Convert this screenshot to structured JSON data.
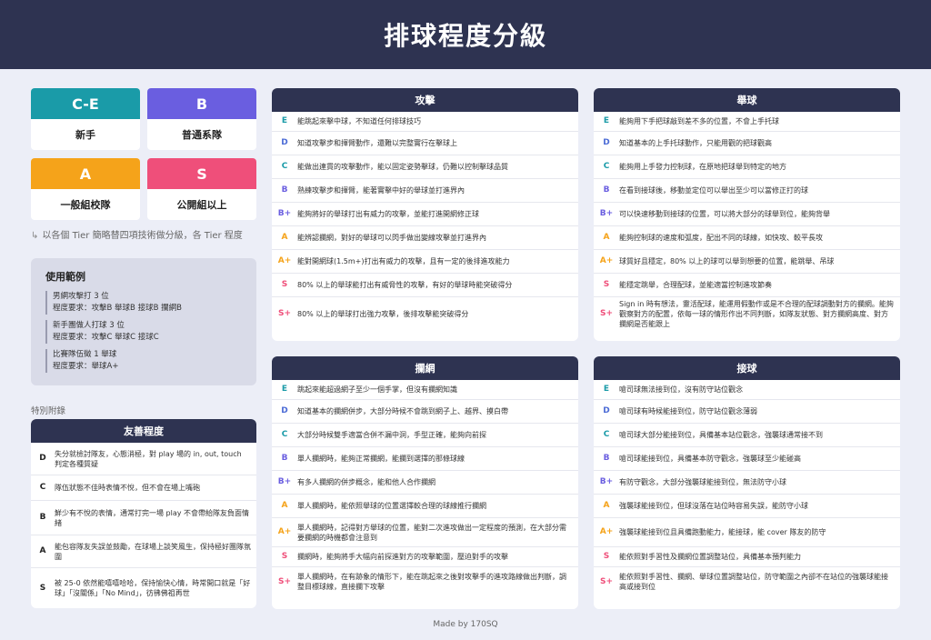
{
  "title": "排球程度分級",
  "colors": {
    "header_bg": "#2e3351",
    "E": "#1a9ba8",
    "D": "#4b6bd6",
    "C": "#1a9ba8",
    "B": "#6a5ee0",
    "Bplus": "#6a5ee0",
    "A": "#f5a31a",
    "Aplus": "#f5a31a",
    "S": "#ef4f7a",
    "Splus": "#ef4f7a"
  },
  "tiers": [
    {
      "badge": "C-E",
      "label": "新手",
      "color": "#1a9ba8"
    },
    {
      "badge": "B",
      "label": "普通系隊",
      "color": "#6a5ee0"
    },
    {
      "badge": "A",
      "label": "一般組校隊",
      "color": "#f5a31a"
    },
    {
      "badge": "S",
      "label": "公開組以上",
      "color": "#ef4f7a"
    }
  ],
  "note": "以各個 Tier 簡略替四項技術做分級，各 Tier 程度",
  "example": {
    "title": "使用範例",
    "items": [
      {
        "line1": "男網攻擊打 3 位",
        "line2": "程度要求：攻擊B 舉球B 接球B 攔網B"
      },
      {
        "line1": "新手團做人打球 3 位",
        "line2": "程度要求：攻擊C 舉球C 接球C"
      },
      {
        "line1": "比賽隊伍徵 1 舉球",
        "line2": "程度要求：舉球A+"
      }
    ]
  },
  "special_label": "特別附錄",
  "friendly": {
    "title": "友善程度",
    "rows": [
      {
        "lvl": "D",
        "desc": "失分就檢討隊友，心態消極，對 play 場的 in, out, touch 判定各種質疑"
      },
      {
        "lvl": "C",
        "desc": "隊伍狀態不佳時表情不悅，但不會在場上嘴砲"
      },
      {
        "lvl": "B",
        "desc": "鮮少有不悅的表情，通常打完一場 play 不會帶給隊友負面情緒"
      },
      {
        "lvl": "A",
        "desc": "能包容隊友失誤並鼓勵，在球場上談笑風生，保持極好團隊氛圍"
      },
      {
        "lvl": "S",
        "desc": "被 25-0 依然能嘻嘻哈哈，保持愉快心情，時常開口就是「好球」「沒關係」「No Mind」，彷彿佛祖再世"
      }
    ]
  },
  "panels": {
    "attack": {
      "title": "攻擊",
      "rows": [
        {
          "lvl": "E",
          "desc": "能跳起來擊中球，不知道任何排球技巧"
        },
        {
          "lvl": "D",
          "desc": "知道攻擊步和揮臂動作，還難以完整實行在擊球上"
        },
        {
          "lvl": "C",
          "desc": "能做出連貫的攻擊動作，能以固定姿勢擊球，仍難以控制擊球品質"
        },
        {
          "lvl": "B",
          "desc": "熟練攻擊步和揮臂，能著實擊中好的舉球並打進界內"
        },
        {
          "lvl": "B+",
          "desc": "能夠將好的舉球打出有威力的攻擊，並能打進開網修正球"
        },
        {
          "lvl": "A",
          "desc": "能辨認攔網，對好的舉球可以閃手做出變線攻擊並打進界內"
        },
        {
          "lvl": "A+",
          "desc": "能對開網球(1.5m+)打出有威力的攻擊，且有一定的後排進攻能力"
        },
        {
          "lvl": "S",
          "desc": "80% 以上的舉球能打出有威脅性的攻擊，有好的舉球時能突破得分"
        },
        {
          "lvl": "S+",
          "desc": "80% 以上的舉球打出強力攻擊，後排攻擊能突破得分"
        }
      ]
    },
    "setting": {
      "title": "舉球",
      "rows": [
        {
          "lvl": "E",
          "desc": "能夠用下手把球敲到差不多的位置，不會上手托球"
        },
        {
          "lvl": "D",
          "desc": "知道基本的上手托球動作，只能用觀的把球觀高"
        },
        {
          "lvl": "C",
          "desc": "能夠用上手發力控制球，在原地把球舉到特定的地方"
        },
        {
          "lvl": "B",
          "desc": "在看到接球後，移動並定位可以舉出至少可以當修正打的球"
        },
        {
          "lvl": "B+",
          "desc": "可以快速移動到接球的位置，可以將大部分的球舉到位，能夠背舉"
        },
        {
          "lvl": "A",
          "desc": "能夠控制球的速度和弧度，配出不同的球線，如快攻、較平長攻"
        },
        {
          "lvl": "A+",
          "desc": "球質好且穩定，80% 以上的球可以舉到想要的位置，能跳舉、吊球"
        },
        {
          "lvl": "S",
          "desc": "能穩定跳舉，合理配球，並能適當控制進攻節奏"
        },
        {
          "lvl": "S+",
          "desc": "Sign in 時有想法，靈活配球，能運用假動作或是不合理的配球調動對方的攔網。能夠觀察對方的配置，依每一球的情形作出不同判斷，如隊友狀態、對方攔網高度、對方攔網是否能跟上"
        }
      ]
    },
    "blocking": {
      "title": "攔網",
      "rows": [
        {
          "lvl": "E",
          "desc": "跳起來能超過網子至少一個手掌，但沒有攔網知識"
        },
        {
          "lvl": "D",
          "desc": "知道基本的攔網併步，大部分時候不會跳到網子上、越界、摸白帶"
        },
        {
          "lvl": "C",
          "desc": "大部分時候雙手適當合併不漏中洞，手型正確，能夠向前探"
        },
        {
          "lvl": "B",
          "desc": "單人攔網時，能夠正常攔網，能攔到選擇的那條球線"
        },
        {
          "lvl": "B+",
          "desc": "有多人攔網的併步概念，能和他人合作攔網"
        },
        {
          "lvl": "A",
          "desc": "單人攔網時，能依照舉球的位置選擇較合理的球線推行攔網"
        },
        {
          "lvl": "A+",
          "desc": "單人攔網時，記得對方舉球的位置，能對二次進攻做出一定程度的預測，在大部分需要攔網的時機都會注意到"
        },
        {
          "lvl": "S",
          "desc": "攔網時，能夠將手大幅向前探進對方的攻擊範圍，壓迫對手的攻擊"
        },
        {
          "lvl": "S+",
          "desc": "單人攔網時，在有跡象的情形下，能在跳起來之後對攻擊手的進攻路線做出判斷，調整目標球線，直接攔下攻擊"
        }
      ]
    },
    "receiving": {
      "title": "接球",
      "rows": [
        {
          "lvl": "E",
          "desc": "嗆司球無法接到位，沒有防守站位觀念"
        },
        {
          "lvl": "D",
          "desc": "嗆司球有時候能接到位，防守站位觀念薄弱"
        },
        {
          "lvl": "C",
          "desc": "嗆司球大部分能接到位，具備基本站位觀念，強襲球通常接不到"
        },
        {
          "lvl": "B",
          "desc": "嗆司球能接到位，具備基本防守觀念，強襲球至少能碰高"
        },
        {
          "lvl": "B+",
          "desc": "有防守觀念，大部分強襲球能接到位，無法防守小球"
        },
        {
          "lvl": "A",
          "desc": "強襲球能接到位，但球沒落在站位時容易失誤，能防守小球"
        },
        {
          "lvl": "A+",
          "desc": "強襲球能接到位且具備跑動能力，能接球，能 cover 隊友的防守"
        },
        {
          "lvl": "S",
          "desc": "能依照對手習性及攔網位置調整站位，具備基本預判能力"
        },
        {
          "lvl": "S+",
          "desc": "能依照對手習性、攔網、舉球位置調整站位，防守範圍之內卻不在站位的強襲球能接高或接到位"
        }
      ]
    }
  },
  "footer": "Made by 170SQ"
}
